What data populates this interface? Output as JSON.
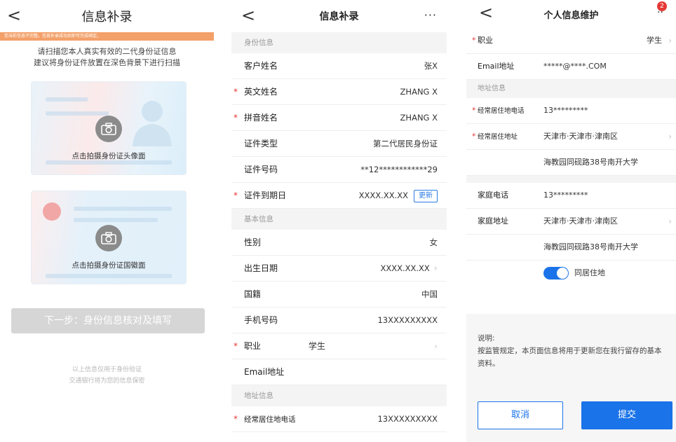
{
  "p1": {
    "title": "信息补录",
    "back": "<",
    "warning": "您当前信息不完整。信息补录成功后即可完成绑定。",
    "inst1": "请扫描您本人真实有效的二代身份证信息",
    "inst2": "建议将身份证件放置在深色背景下进行扫描",
    "card1_label": "点击拍摄身份证头像面",
    "card2_label": "点击拍摄身份证国徽面",
    "next_label": "下一步：身份信息核对及填写",
    "foot1": "以上信息仅用于身份验证",
    "foot2": "交通银行将为您的信息保密"
  },
  "p2": {
    "title": "信息补录",
    "back": "<",
    "more": "···",
    "sec1": "身份信息",
    "name_label": "客户姓名",
    "name_value": "张X",
    "en_label": "英文姓名",
    "en_value": "ZHANG X",
    "py_label": "拼音姓名",
    "py_value": "ZHANG X",
    "idtype_label": "证件类型",
    "idtype_value": "第二代居民身份证",
    "idno_label": "证件号码",
    "idno_value": "**12************29",
    "exp_label": "证件到期日",
    "exp_value": "XXXX.XX.XX",
    "update_label": "更新",
    "sec2": "基本信息",
    "sex_label": "性别",
    "sex_value": "女",
    "dob_label": "出生日期",
    "dob_value": "XXXX.XX.XX",
    "nat_label": "国籍",
    "nat_value": "中国",
    "phone_label": "手机号码",
    "phone_value": "13XXXXXXXXX",
    "job_label": "职业",
    "job_value": "学生",
    "email_label": "Email地址",
    "sec3": "地址信息",
    "addrtel_label": "经常居住地电话",
    "addrtel_value": "13XXXXXXXXX"
  },
  "p3": {
    "title": "个人信息维护",
    "back": "<",
    "more": "··",
    "badge": "2",
    "job_label": "职业",
    "job_value": "学生",
    "email_label": "Email地址",
    "email_value": "*****@****.COM",
    "sec": "地址信息",
    "tel_label": "经常居住地电话",
    "tel_value": "13*********",
    "addr_label": "经常居住地址",
    "addr_value": "天津市·天津市·津南区",
    "addr_detail": "海教园同砚路38号南开大学",
    "home_tel_label": "家庭电话",
    "home_tel_value": "13*********",
    "home_addr_label": "家庭地址",
    "home_addr_value": "天津市·天津市·津南区",
    "home_addr_detail": "海教园同砚路38号南开大学",
    "same_label": "同居住地",
    "note_title": "说明:",
    "note_body": "按监管规定，本页面信息将用于更新您在我行留存的基本资料。",
    "cancel": "取消",
    "submit": "提交"
  },
  "colors": {
    "primary": "#1a73e8",
    "required": "#e53935",
    "warning": "#f3a06a",
    "disabled": "#d6d6d6"
  }
}
